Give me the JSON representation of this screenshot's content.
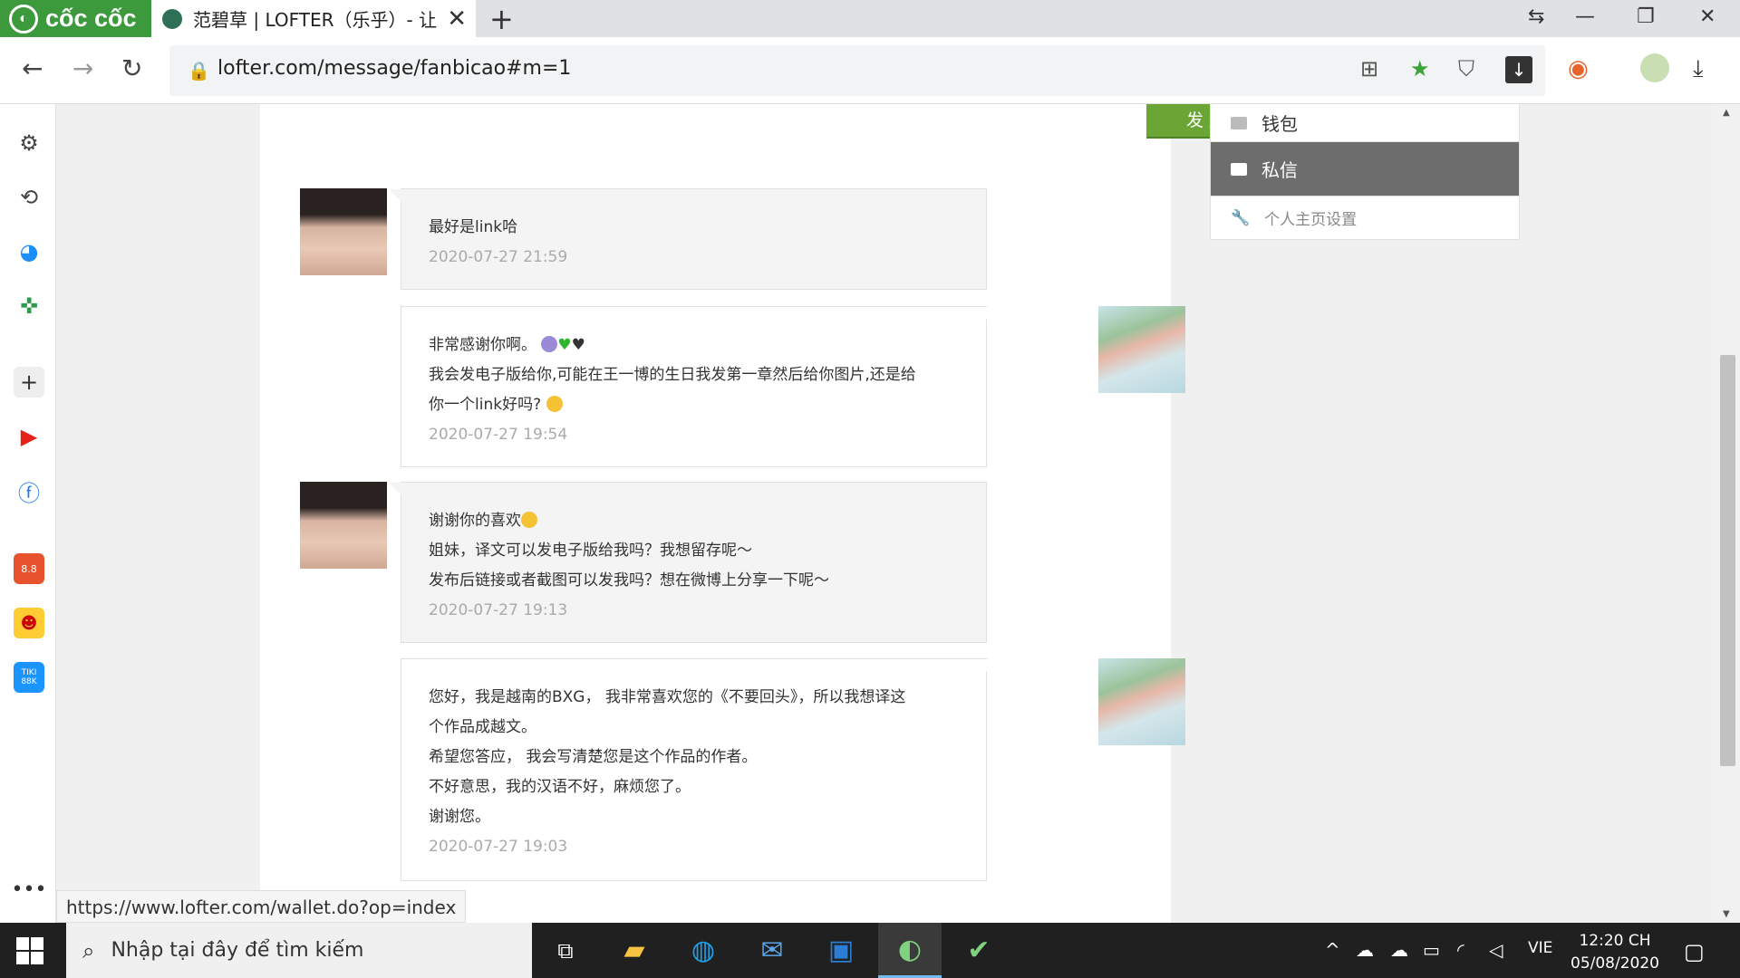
{
  "browser": {
    "brand": "cốc cốc",
    "tab_title": "范碧草 | LOFTER（乐乎）- 让",
    "url": "lofter.com/message/fanbicao#m=1",
    "status_url": "https://www.lofter.com/wallet.do?op=index"
  },
  "sidebar_icons": [
    "gear-icon",
    "history-icon",
    "messenger-icon",
    "game-icon",
    "add-icon",
    "youtube-icon",
    "facebook-icon",
    "shopee-icon",
    "game-app-icon",
    "tiki-icon",
    "more-icon"
  ],
  "sidebar_badges": {
    "shopee": "8.8",
    "tiki": "TIKI 88K"
  },
  "page": {
    "send_button": "发 送",
    "messages": [
      {
        "from": "them",
        "lines": [
          "最好是link哈"
        ],
        "time": "2020-07-27 21:59"
      },
      {
        "from": "me",
        "lines": [
          "非常感谢你啊。",
          "我会发电子版给你,可能在王一博的生日我发第一章然后给你图片,还是给",
          "你一个link好吗?"
        ],
        "time": "2020-07-27 19:54"
      },
      {
        "from": "them",
        "lines": [
          "谢谢你的喜欢",
          "姐妹，译文可以发电子版给我吗？我想留存呢～",
          "发布后链接或者截图可以发我吗？想在微博上分享一下呢～"
        ],
        "time": "2020-07-27 19:13"
      },
      {
        "from": "me",
        "lines": [
          "您好，我是越南的BXG， 我非常喜欢您的《不要回头》，所以我想译这",
          "个作品成越文。",
          "希望您答应， 我会写清楚您是这个作品的作者。",
          "不好意思，我的汉语不好，麻烦您了。",
          "谢谢您。"
        ],
        "time": "2020-07-27 19:03"
      }
    ],
    "menu": {
      "wallet": "钱包",
      "messages": "私信",
      "settings": "个人主页设置"
    }
  },
  "taskbar": {
    "search_placeholder": "Nhập tại đây để tìm kiếm",
    "lang": "VIE",
    "time": "12:20 CH",
    "date": "05/08/2020"
  },
  "colors": {
    "accent_green": "#6aa535",
    "brand_green": "#3c9a3c",
    "menu_active": "#6d6d6d"
  }
}
